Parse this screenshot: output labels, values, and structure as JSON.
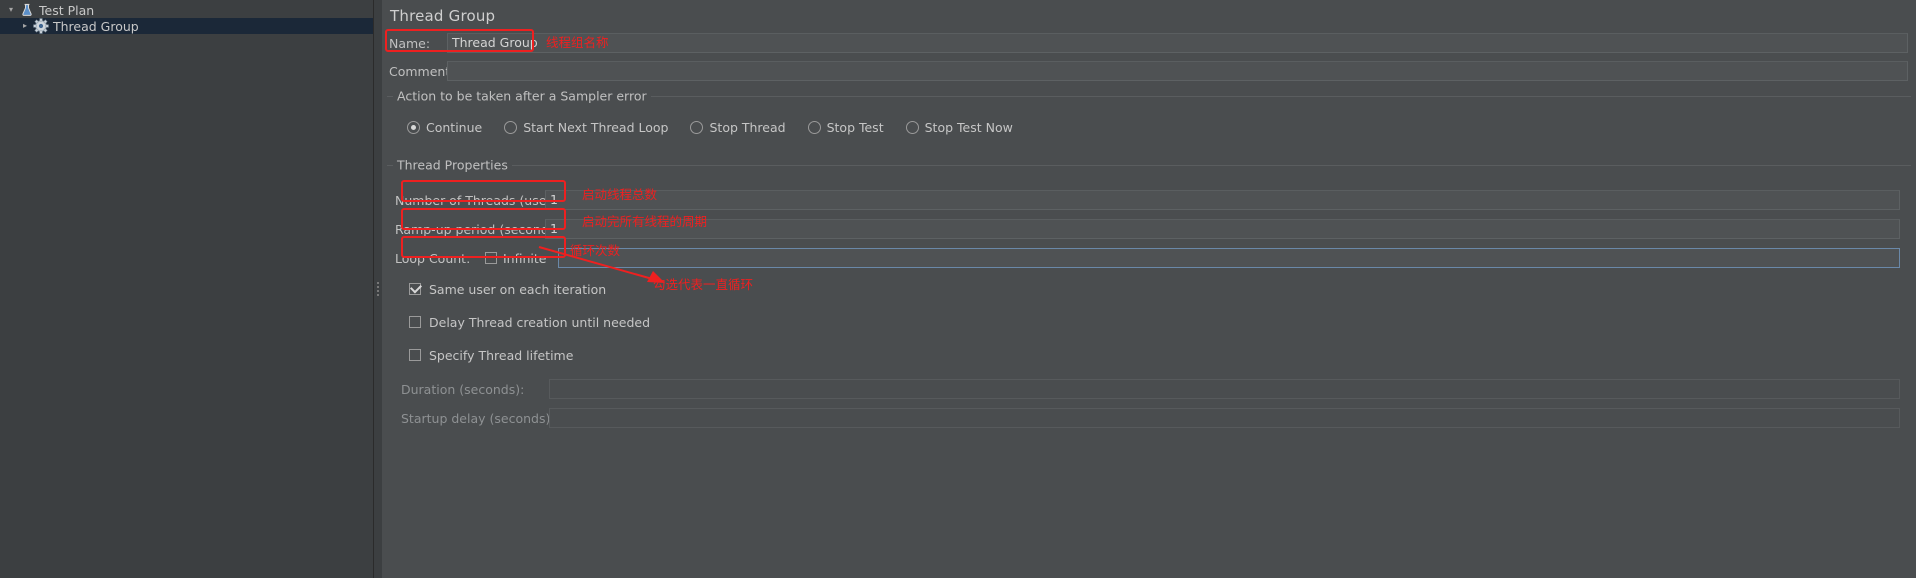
{
  "tree": {
    "items": [
      {
        "label": "Test Plan",
        "icon": "test-plan-icon",
        "twisty": "▾",
        "selected": false,
        "depth": 0
      },
      {
        "label": "Thread Group",
        "icon": "thread-group-gear-icon",
        "twisty": "▸",
        "selected": true,
        "depth": 1
      }
    ]
  },
  "panel": {
    "title": "Thread Group",
    "name_label": "Name:",
    "name_value": "Thread Group",
    "comments_label": "Comments:",
    "comments_value": ""
  },
  "sampler_error": {
    "legend": "Action to be taken after a Sampler error",
    "options": [
      {
        "label": "Continue",
        "selected": true
      },
      {
        "label": "Start Next Thread Loop",
        "selected": false
      },
      {
        "label": "Stop Thread",
        "selected": false
      },
      {
        "label": "Stop Test",
        "selected": false
      },
      {
        "label": "Stop Test Now",
        "selected": false
      }
    ]
  },
  "thread_properties": {
    "legend": "Thread Properties",
    "num_threads_label": "Number of Threads (users):",
    "num_threads_value": "1",
    "rampup_label": "Ramp-up period (seconds):",
    "rampup_value": "1",
    "loop_count_label": "Loop Count:",
    "loop_infinite_label": "Infinite",
    "loop_infinite_checked": false,
    "loop_count_value": "",
    "same_user_label": "Same user on each iteration",
    "same_user_checked": true,
    "delay_thread_label": "Delay Thread creation until needed",
    "delay_thread_checked": false,
    "specify_lifetime_label": "Specify Thread lifetime",
    "specify_lifetime_checked": false,
    "duration_label": "Duration (seconds):",
    "duration_value": "",
    "startup_delay_label": "Startup delay (seconds):",
    "startup_delay_value": ""
  },
  "annotations": {
    "accent_color": "#ee2020",
    "name": "线程组名称",
    "num_threads": "启动线程总数",
    "rampup": "启动完所有线程的周期",
    "loop_count": "循环次数",
    "infinite_hint": "勾选代表一直循环"
  }
}
